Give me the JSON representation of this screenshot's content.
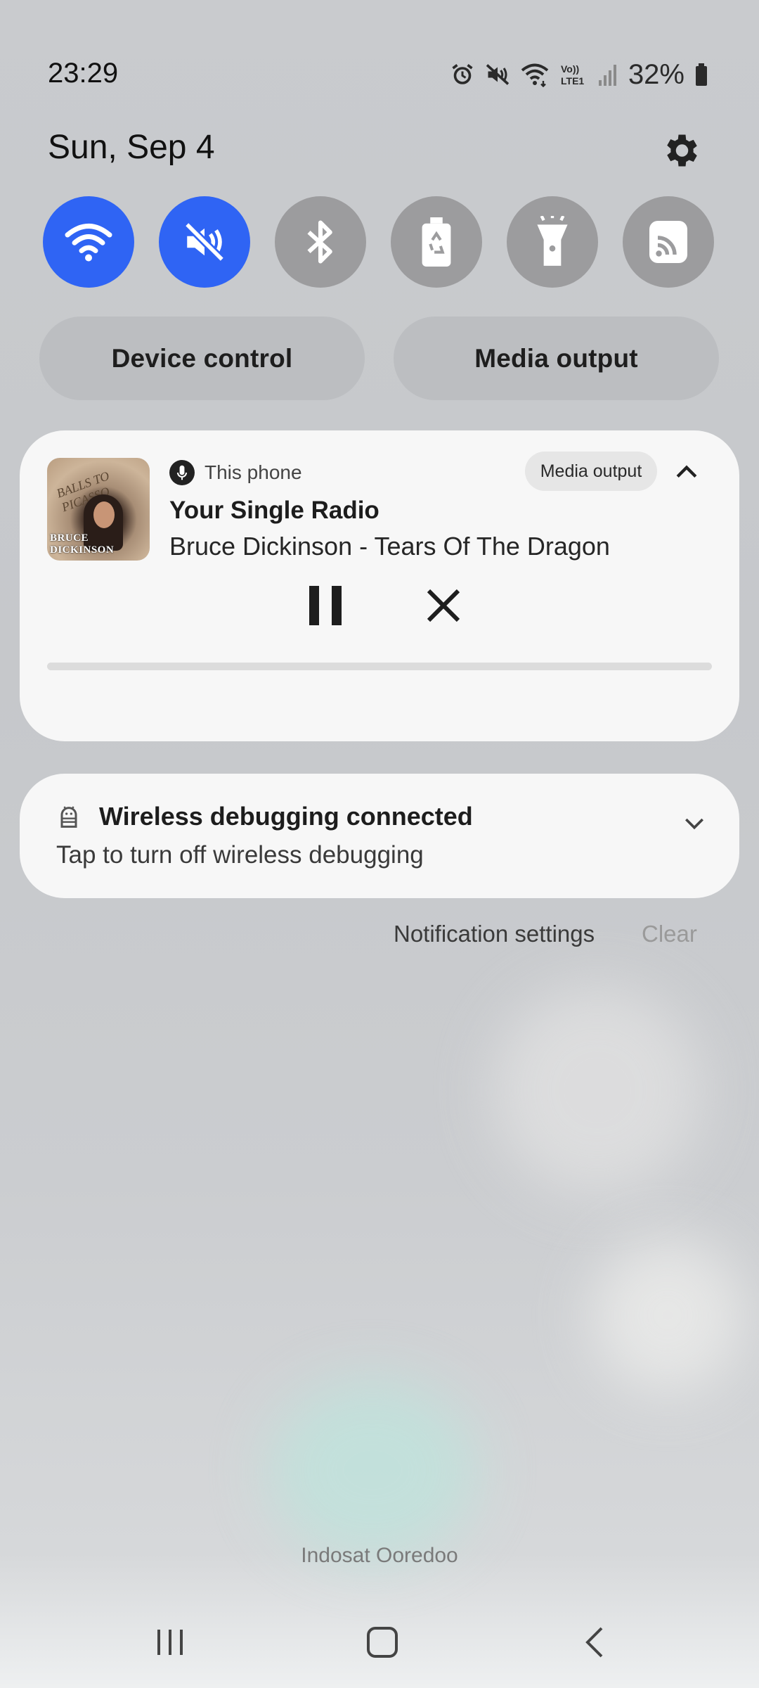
{
  "status_bar": {
    "time": "23:29",
    "battery": "32%",
    "icons": [
      "alarm-icon",
      "mute-icon",
      "wifi-icon",
      "volte-lte-icon",
      "signal-icon",
      "battery-icon"
    ],
    "network_label": "Vo) LTE1"
  },
  "header": {
    "date": "Sun, Sep 4",
    "settings_icon": "gear-icon"
  },
  "quick_tiles": [
    {
      "name": "wifi",
      "icon": "wifi-icon",
      "active": true
    },
    {
      "name": "sound",
      "icon": "mute-icon",
      "active": true
    },
    {
      "name": "bluetooth",
      "icon": "bluetooth-icon",
      "active": false
    },
    {
      "name": "power-saving",
      "icon": "battery-saver-icon",
      "active": false
    },
    {
      "name": "flashlight",
      "icon": "flashlight-icon",
      "active": false
    },
    {
      "name": "cast",
      "icon": "cast-icon",
      "active": false
    }
  ],
  "pills": {
    "device_control": "Device control",
    "media_output": "Media output"
  },
  "media": {
    "source": "This phone",
    "output_button": "Media output",
    "title": "Your Single Radio",
    "subtitle": "Bruce Dickinson - Tears Of The Dragon",
    "album_text": "BRUCE DICKINSON",
    "album_scribble": "BALLS TO PICASSO",
    "progress": 0
  },
  "notification": {
    "title": "Wireless debugging connected",
    "body": "Tap to turn off wireless debugging"
  },
  "footer": {
    "notification_settings": "Notification settings",
    "clear": "Clear",
    "carrier": "Indosat Ooredoo"
  },
  "colors": {
    "accent": "#2f64f4",
    "tile_off": "#9c9c9e",
    "card": "#f7f7f7"
  }
}
